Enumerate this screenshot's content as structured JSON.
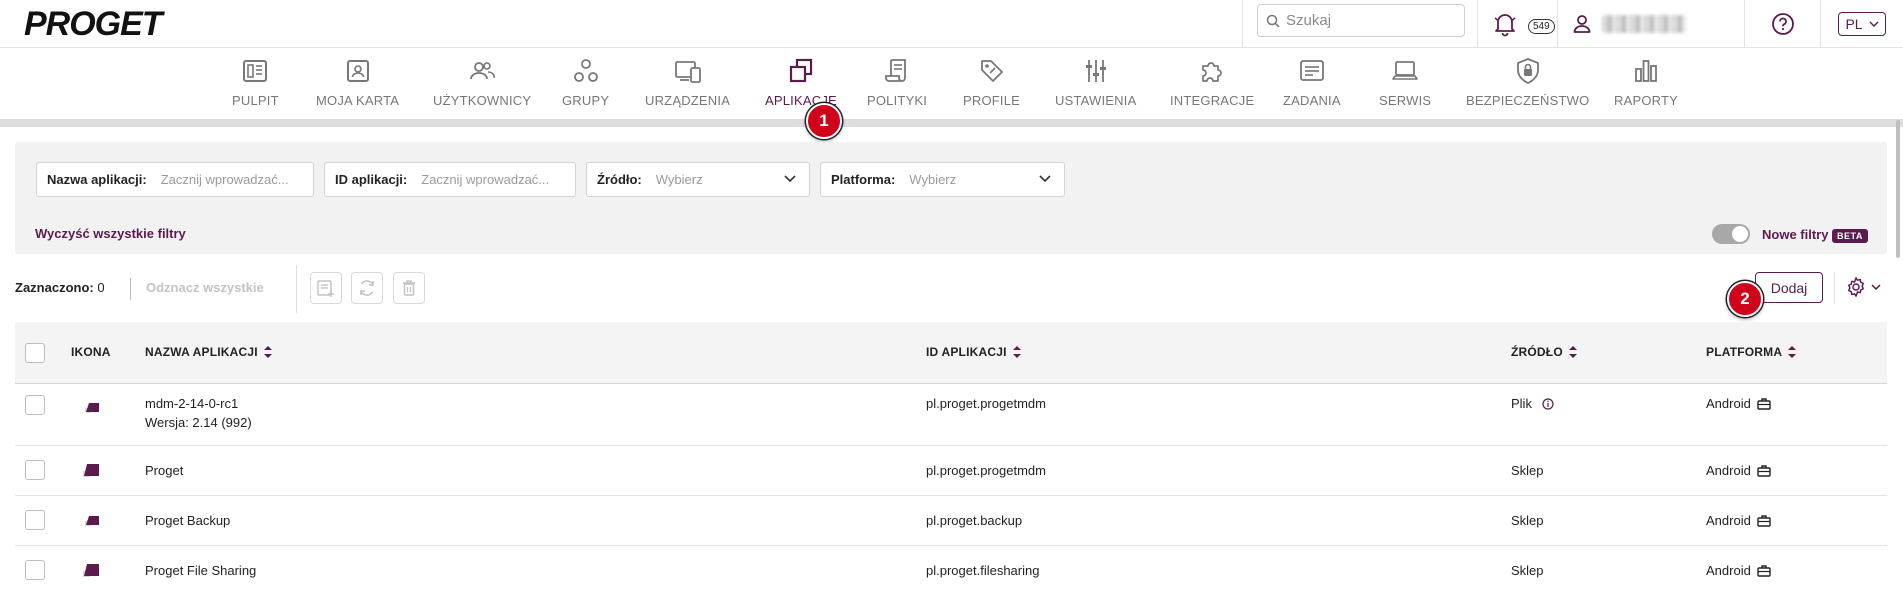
{
  "brand": {
    "logo": "PROGET",
    "accent": "#5b1b4e"
  },
  "topbar": {
    "search_placeholder": "Szukaj",
    "notifications_count": "549",
    "language": "PL"
  },
  "nav": [
    {
      "label": "PULPIT",
      "icon": "dashboard-icon"
    },
    {
      "label": "MOJA KARTA",
      "icon": "id-card-icon"
    },
    {
      "label": "UŻYTKOWNICY",
      "icon": "users-icon"
    },
    {
      "label": "GRUPY",
      "icon": "groups-icon"
    },
    {
      "label": "URZĄDZENIA",
      "icon": "devices-icon"
    },
    {
      "label": "APLIKACJE",
      "icon": "applications-icon",
      "active": true
    },
    {
      "label": "POLITYKI",
      "icon": "policies-icon"
    },
    {
      "label": "PROFILE",
      "icon": "profiles-tag-icon"
    },
    {
      "label": "USTAWIENIA",
      "icon": "settings-sliders-icon"
    },
    {
      "label": "INTEGRACJE",
      "icon": "puzzle-icon"
    },
    {
      "label": "ZADANIA",
      "icon": "tasks-icon"
    },
    {
      "label": "SERWIS",
      "icon": "laptop-icon"
    },
    {
      "label": "BEZPIECZEŃSTWO",
      "icon": "shield-lock-icon"
    },
    {
      "label": "RAPORTY",
      "icon": "bar-chart-icon"
    }
  ],
  "markers": [
    "1",
    "2"
  ],
  "filters": {
    "app_name_label": "Nazwa aplikacji:",
    "app_name_placeholder": "Zacznij wprowadzać...",
    "app_id_label": "ID aplikacji:",
    "app_id_placeholder": "Zacznij wprowadzać...",
    "source_label": "Źródło:",
    "source_value": "Wybierz",
    "platform_label": "Platforma:",
    "platform_value": "Wybierz",
    "clear_all": "Wyczyść wszystkie filtry",
    "new_filters": "Nowe filtry",
    "beta": "BETA"
  },
  "toolbar": {
    "selected_label": "Zaznaczono:",
    "selected_count": "0",
    "unselect_all": "Odznacz wszystkie",
    "add_button": "Dodaj"
  },
  "table": {
    "columns": [
      "IKONA",
      "NAZWA APLIKACJI",
      "ID APLIKACJI",
      "ŹRÓDŁO",
      "PLATFORMA"
    ],
    "rows": [
      {
        "name": "mdm-2-14-0-rc1",
        "version": "Wersja: 2.14 (992)",
        "id": "pl.proget.progetmdm",
        "source": "Plik",
        "platform": "Android"
      },
      {
        "name": "Proget",
        "version": "",
        "id": "pl.proget.progetmdm",
        "source": "Sklep",
        "platform": "Android"
      },
      {
        "name": "Proget Backup",
        "version": "",
        "id": "pl.proget.backup",
        "source": "Sklep",
        "platform": "Android"
      },
      {
        "name": "Proget File Sharing",
        "version": "",
        "id": "pl.proget.filesharing",
        "source": "Sklep",
        "platform": "Android"
      }
    ]
  }
}
